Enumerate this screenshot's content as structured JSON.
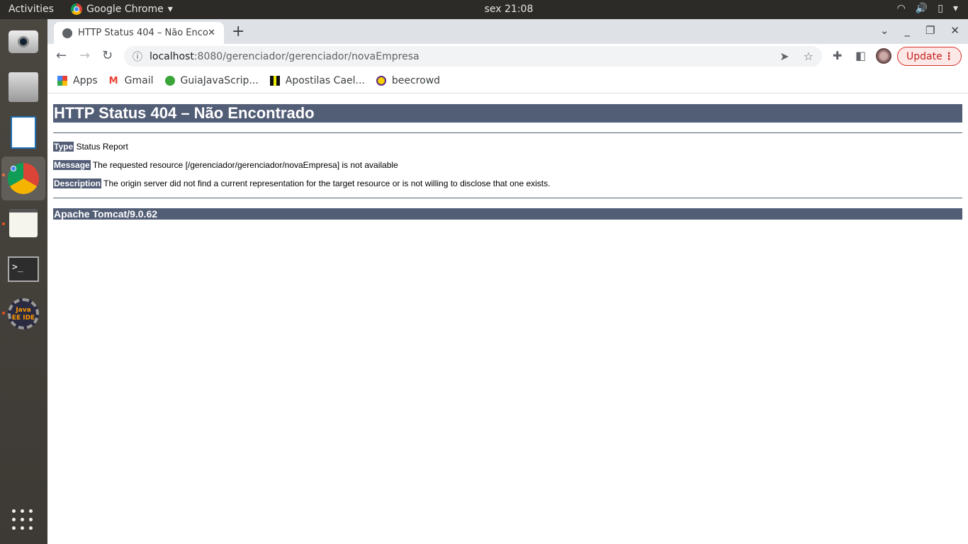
{
  "system": {
    "activities": "Activities",
    "app_name": "Google Chrome",
    "clock": "sex 21:08"
  },
  "dock": [
    "camera",
    "files",
    "libreoffice-impress",
    "google-chrome",
    "text-editor",
    "terminal",
    "eclipse-java-ee"
  ],
  "dock_labels": {
    "eclipse": "Java EE IDE"
  },
  "browser": {
    "tab_title": "HTTP Status 404 – Não Encontrado",
    "url_host": "localhost",
    "url_rest": ":8080/gerenciador/gerenciador/novaEmpresa",
    "update_label": "Update",
    "bookmarks": [
      {
        "label": "Apps",
        "icon": "apps-grid-icon"
      },
      {
        "label": "Gmail",
        "icon": "gmail-icon"
      },
      {
        "label": "GuiaJavaScrip...",
        "icon": "guia-icon"
      },
      {
        "label": "Apostilas Cael...",
        "icon": "caelum-icon"
      },
      {
        "label": "beecrowd",
        "icon": "beecrowd-icon"
      }
    ]
  },
  "page": {
    "title": "HTTP Status 404 – Não Encontrado",
    "type_label": "Type",
    "type_value": "Status Report",
    "message_label": "Message",
    "message_value": "The requested resource [/gerenciador/gerenciador/novaEmpresa] is not available",
    "description_label": "Description",
    "description_value": "The origin server did not find a current representation for the target resource or is not willing to disclose that one exists.",
    "footer": "Apache Tomcat/9.0.62"
  },
  "colors": {
    "tomcat_bar": "#525d76",
    "update_red": "#d93025"
  }
}
